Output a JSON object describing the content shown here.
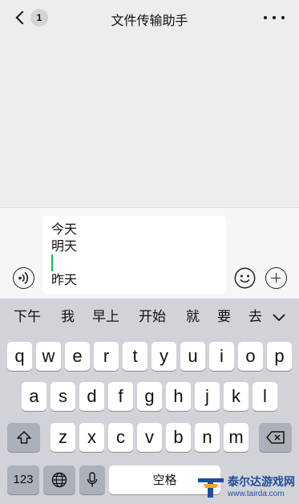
{
  "header": {
    "title": "文件传输助手",
    "unread_count": "1"
  },
  "input": {
    "lines": [
      "今天",
      "明天",
      "昨天"
    ]
  },
  "candidates": [
    "下午",
    "我",
    "早上",
    "开始",
    "就",
    "要",
    "去"
  ],
  "keyboard": {
    "row1": [
      "q",
      "w",
      "e",
      "r",
      "t",
      "y",
      "u",
      "i",
      "o",
      "p"
    ],
    "row2": [
      "a",
      "s",
      "d",
      "f",
      "g",
      "h",
      "j",
      "k",
      "l"
    ],
    "row3": [
      "z",
      "x",
      "c",
      "v",
      "b",
      "n",
      "m"
    ],
    "numbers_label": "123",
    "space_label": "空格"
  },
  "watermark": {
    "brand": "泰尔达游戏网",
    "url": "www.tairda.com"
  },
  "colors": {
    "caret": "#07c160",
    "keyboard_bg": "#d1d3d9",
    "chat_bg": "#ededed"
  }
}
